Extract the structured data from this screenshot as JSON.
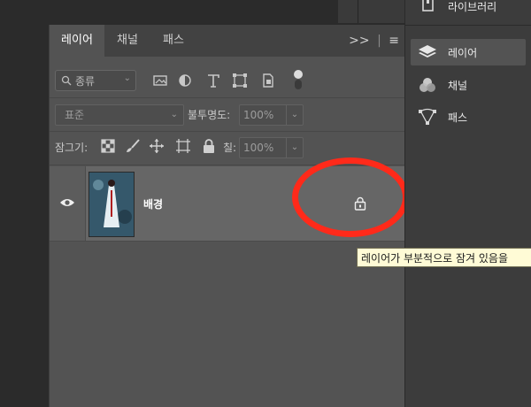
{
  "tabs": [
    "레이어",
    "채널",
    "패스"
  ],
  "tabbar_controls": {
    "collapse": ">>",
    "menu": "≡"
  },
  "filter": {
    "label": "종류",
    "icons": [
      "image-filter-icon",
      "adjustment-filter-icon",
      "text-filter-icon",
      "shape-filter-icon",
      "smart-object-filter-icon",
      "filter-toggle-icon"
    ]
  },
  "blend": {
    "mode": "표준",
    "opacity_label": "불투명도:",
    "opacity_value": "100%"
  },
  "lock": {
    "label": "잠그기:",
    "fill_label": "칠:",
    "fill_value": "100%",
    "icons": [
      "lock-transparent-icon",
      "lock-paint-icon",
      "lock-move-icon",
      "lock-artboard-icon",
      "lock-all-icon"
    ]
  },
  "layers": [
    {
      "name": "배경",
      "visible": true,
      "locked": true
    }
  ],
  "tooltip": "레이어가 부분적으로 잠겨 있음을",
  "sidebar": {
    "items": [
      {
        "label": "라이브러리",
        "icon": "library-icon"
      },
      {
        "label": "레이어",
        "icon": "layers-icon",
        "active": true
      },
      {
        "label": "채널",
        "icon": "channels-icon"
      },
      {
        "label": "패스",
        "icon": "paths-icon"
      }
    ]
  },
  "colors": {
    "annotation": "#ff2a1a",
    "panel": "#535353",
    "tooltip_bg": "#fffbd6"
  }
}
